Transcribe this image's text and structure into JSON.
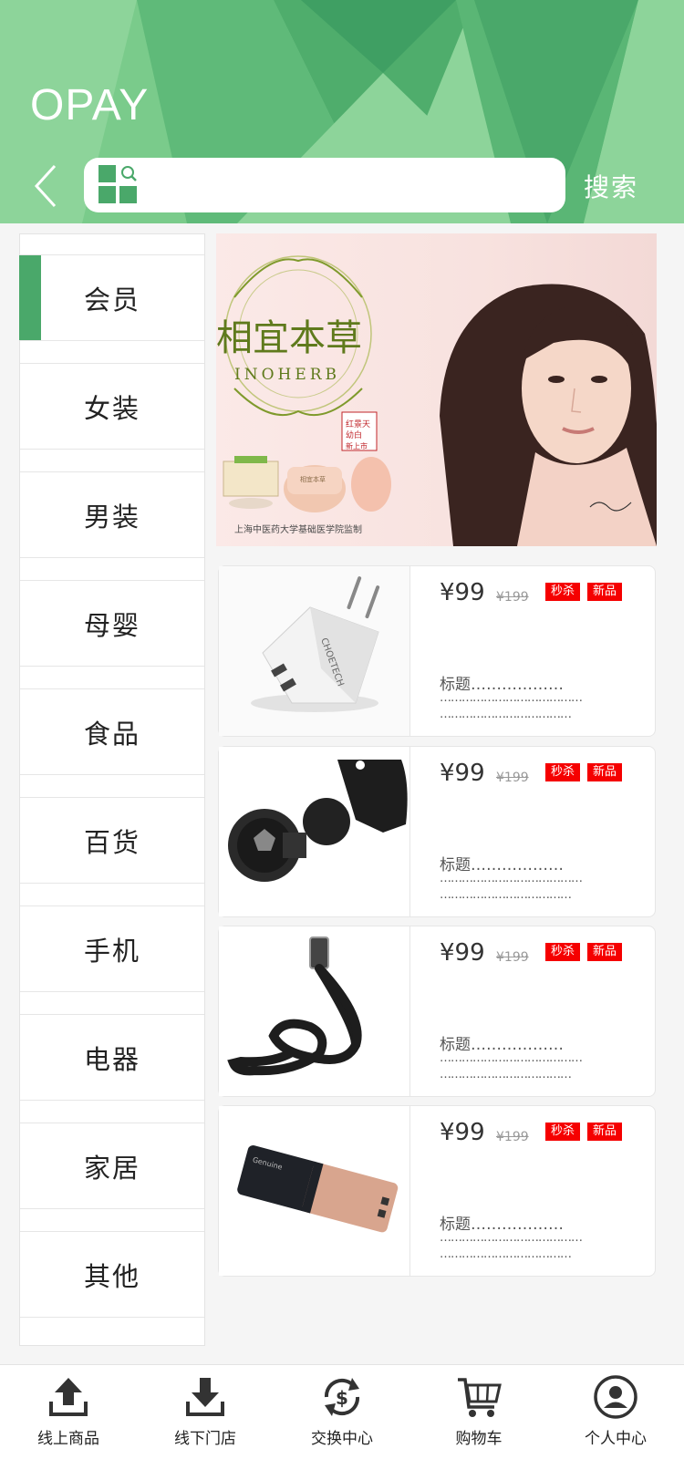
{
  "header": {
    "brand": "OPAY",
    "search_placeholder": "",
    "search_button": "搜索",
    "back_icon": "chevron-left-icon",
    "colors": {
      "light": "#8dd49a",
      "mid": "#6cc080",
      "dark": "#3f9f63"
    }
  },
  "sidebar": {
    "active_color": "#4aa86a",
    "items": [
      {
        "label": "会员",
        "active": true
      },
      {
        "label": "女装"
      },
      {
        "label": "男装"
      },
      {
        "label": "母婴"
      },
      {
        "label": "食品"
      },
      {
        "label": "百货"
      },
      {
        "label": "手机"
      },
      {
        "label": "电器"
      },
      {
        "label": "家居"
      },
      {
        "label": "其他"
      }
    ]
  },
  "banner": {
    "brand_cn": "相宜本草",
    "brand_en": "INOHERB",
    "stamp": [
      "红景天",
      "幼白",
      "新上市"
    ],
    "footer": "上海中医药大学基础医学院监制"
  },
  "products": [
    {
      "image": "usb-charger",
      "price": "¥99",
      "old_price": "¥199",
      "tags": [
        "秒杀",
        "新品"
      ],
      "title": "标题………………",
      "desc1": "…………………………………",
      "desc2": "………………………………"
    },
    {
      "image": "magnetic-car-mount",
      "price": "¥99",
      "old_price": "¥199",
      "tags": [
        "秒杀",
        "新品"
      ],
      "title": "标题………………",
      "desc1": "…………………………………",
      "desc2": "………………………………"
    },
    {
      "image": "leather-belt",
      "price": "¥99",
      "old_price": "¥199",
      "tags": [
        "秒杀",
        "新品"
      ],
      "title": "标题………………",
      "desc1": "…………………………………",
      "desc2": "………………………………"
    },
    {
      "image": "power-bank",
      "price": "¥99",
      "old_price": "¥199",
      "tags": [
        "秒杀",
        "新品"
      ],
      "title": "标题………………",
      "desc1": "…………………………………",
      "desc2": "………………………………"
    }
  ],
  "bottom_nav": {
    "items": [
      {
        "label": "线上商品",
        "icon": "upload-tray-icon"
      },
      {
        "label": "线下门店",
        "icon": "download-tray-icon"
      },
      {
        "label": "交换中心",
        "icon": "currency-exchange-icon"
      },
      {
        "label": "购物车",
        "icon": "shopping-cart-icon"
      },
      {
        "label": "个人中心",
        "icon": "user-circle-icon"
      }
    ]
  },
  "colors": {
    "tag_red": "#f50000",
    "accent_green": "#4aa86a"
  }
}
